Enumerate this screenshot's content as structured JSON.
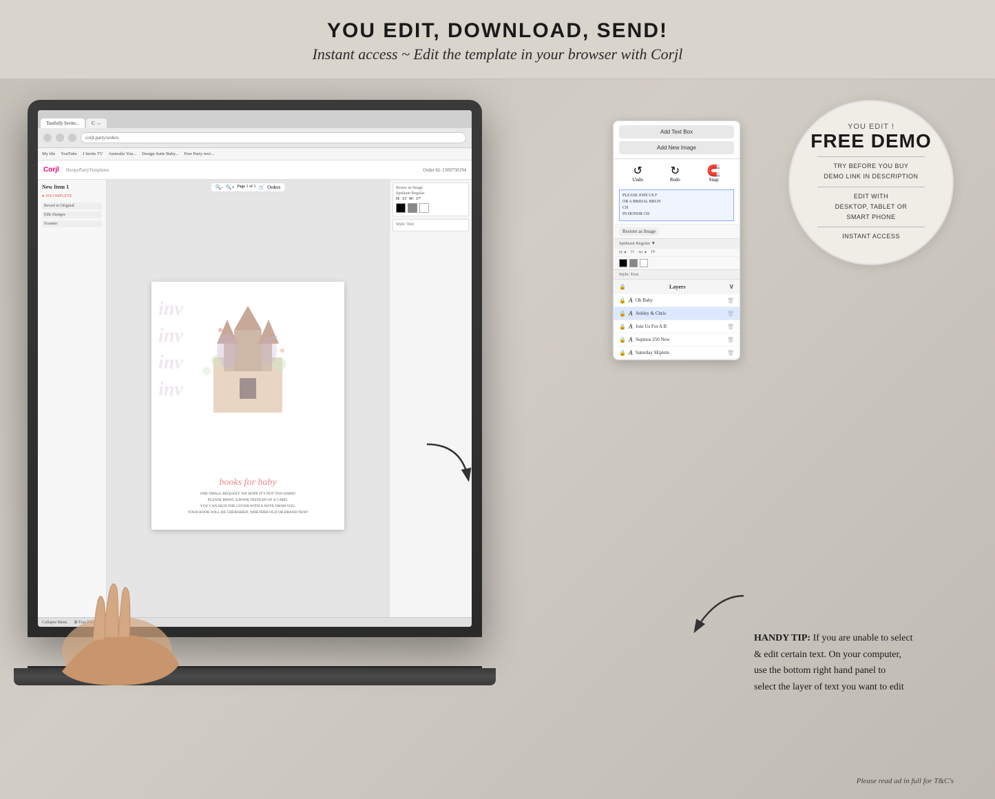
{
  "header": {
    "line1": "YOU EDIT, DOWNLOAD, SEND!",
    "line2": "Instant access ~ Edit the template in your browser with Corjl"
  },
  "circle_badge": {
    "you_edit": "YOU EDIT !",
    "free_demo": "FREE DEMO",
    "line1": "TRY BEFORE YOU BUY",
    "line2": "DEMO LINK IN DESCRIPTION",
    "divider1": "",
    "line3": "EDIT WITH",
    "line4": "DESKTOP, TABLET OR",
    "line5": "SMART PHONE",
    "divider2": "",
    "line6": "INSTANT ACCESS"
  },
  "mobile_panel": {
    "add_text_box": "Add Text Box",
    "add_new_image": "Add New Image",
    "undo": "Undo",
    "redo": "Redo",
    "snap": "Snap",
    "preview_text": "PLEASE JOIN US F\nOR A BRIDAL BRUN\nCH\nIN HONOR CH",
    "style_text": "Style: Text",
    "layers_header": "Layers",
    "layers": [
      {
        "name": "Oh Baby",
        "selected": false
      },
      {
        "name": "Ashley & Chris",
        "selected": true
      },
      {
        "name": "Join Us For A B",
        "selected": false
      },
      {
        "name": "Supinos 250 New",
        "selected": false
      },
      {
        "name": "Saturday SEptem",
        "selected": false
      }
    ]
  },
  "laptop": {
    "browser_tabs": [
      "Tastfully Invite...",
      "C  →",
      "corjl.party/orders"
    ],
    "address": "corjl.party/orders",
    "bookmarks": [
      "My file",
      "YouTube",
      "J Invite TV",
      "Australie You...",
      "Design Suite Baby...",
      "Free Party invi..."
    ],
    "order_id": "Order Id: 1509758194",
    "card_text": "books for baby",
    "card_subtext": "ONE SMALL REQUEST: WE HOPE IT'S NOT TOO HARD!\nPLEASE BRING A BOOK INSTEAD OF A CARD.\nYOU CAN SIGN THE COVER WITH A NOTE FROM YOU.\nYOUR BOOK WILL BE CHERISHED, WHETHER OLD OR BRAND NEW!",
    "incomplete_label": "INCOMPLETE",
    "new_item_1": "New Item 1"
  },
  "tip": {
    "label": "HANDY TIP:",
    "text": " If you are unable to select\n& edit certain text. On your computer,\nuse the bottom right hand panel to\nselect the layer of text you want to edit"
  },
  "footer": {
    "note": "Please read ad in full for T&C's"
  }
}
